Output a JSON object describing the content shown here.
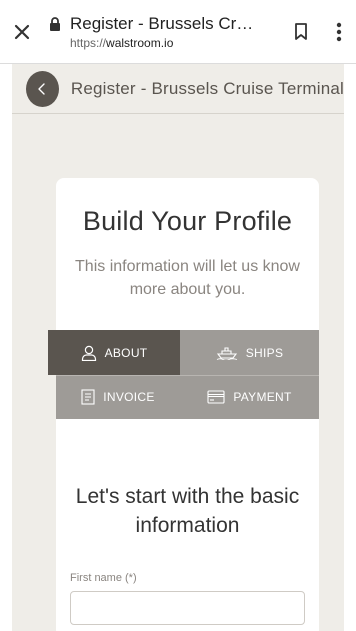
{
  "browser": {
    "tab_title": "Register - Brussels Cruis...",
    "url_prefix": "https://",
    "url_domain": "walstroom.io"
  },
  "header": {
    "title": "Register - Brussels Cruise Terminal"
  },
  "card": {
    "title": "Build Your Profile",
    "subtitle": "This information will let us know more about you."
  },
  "tabs": [
    {
      "label": "ABOUT",
      "icon": "user-icon",
      "active": true
    },
    {
      "label": "SHIPS",
      "icon": "ship-icon",
      "active": false
    },
    {
      "label": "INVOICE",
      "icon": "document-icon",
      "active": false
    },
    {
      "label": "PAYMENT",
      "icon": "credit-card-icon",
      "active": false
    }
  ],
  "form": {
    "section_title": "Let's start with the basic information",
    "first_name_label": "First name (*)",
    "first_name_value": ""
  },
  "colors": {
    "accent_dark": "#5a554f",
    "tab_inactive": "#9e9b97",
    "background": "#efede8"
  }
}
